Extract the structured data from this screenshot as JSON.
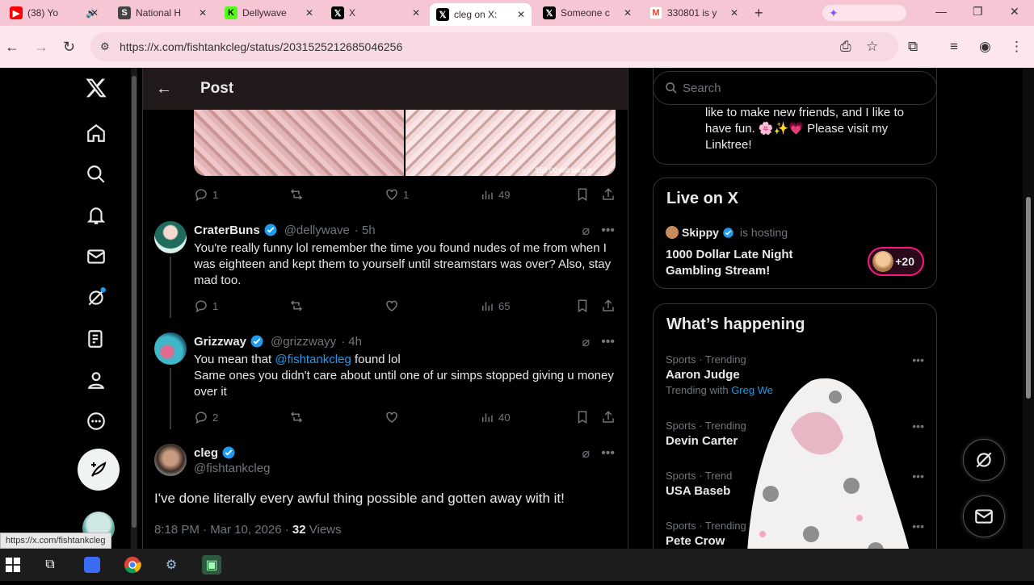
{
  "browser": {
    "tabs": [
      {
        "title": "(38) Yo",
        "icon": "youtube-icon",
        "color": "#ff0000"
      },
      {
        "title": "National H",
        "icon": "s-logo-icon",
        "color": "#333333"
      },
      {
        "title": "Dellywave",
        "icon": "k-logo-icon",
        "color": "#53fc18"
      },
      {
        "title": "X",
        "icon": "x-logo-icon",
        "color": "#000000"
      },
      {
        "title": "cleg on X:",
        "icon": "x-logo-icon",
        "color": "#000000"
      },
      {
        "title": "Someone c",
        "icon": "x-logo-icon",
        "color": "#000000"
      },
      {
        "title": "330801 is y",
        "icon": "gmail-icon",
        "color": "#ea4335"
      }
    ],
    "url": "https://x.com/fishtankcleg/status/2031525212685046256",
    "status_link": "https://x.com/fishtankcleg"
  },
  "header": {
    "title": "Post"
  },
  "image_caption": "$50.00 will take a",
  "parent_post_stats": {
    "replies": "1",
    "likes": "1",
    "views": "49"
  },
  "replies": [
    {
      "name": "CraterBuns",
      "handle": "@dellywave",
      "time": "· 5h",
      "text": "You're really funny lol remember the time you found nudes of me from when I was eighteen and kept them to yourself until streamstars was over?  Also, stay mad too.",
      "replies": "1",
      "views": "65"
    },
    {
      "name": "Grizzway",
      "handle": "@grizzwayy",
      "time": "· 4h",
      "mention": "@fishtankcleg",
      "text_before": "You mean that ",
      "text_after": " found lol",
      "text2": "Same ones you didn't care about until one of ur simps stopped giving u money over it",
      "replies": "2",
      "views": "40"
    }
  ],
  "focused_post": {
    "name": "cleg",
    "handle": "@fishtankcleg",
    "text": "I've done literally every awful thing possible and gotten away with it!",
    "datetime": "8:18 PM · Mar 10, 2026 · ",
    "views_count": "32",
    "views_label": " Views"
  },
  "sidebar": {
    "search_placeholder": "Search",
    "bio_line1": "like to make new friends, and I like to",
    "bio_line2": "have fun. 🌸✨💗 Please visit my",
    "bio_line3": "Linktree!",
    "live": {
      "heading": "Live on X",
      "host": "Skippy",
      "hosting": "is hosting",
      "title": "1000 Dollar Late Night Gambling Stream!",
      "badge": "+20"
    },
    "happening": {
      "heading": "What’s happening",
      "trends": [
        {
          "category": "Sports · Trending",
          "title": "Aaron Judge",
          "with_label": "Trending with",
          "with_link": "Greg We"
        },
        {
          "category": "Sports · Trending",
          "title": "Devin Carter"
        },
        {
          "category": "Sports · Trend",
          "title": "USA Baseb"
        },
        {
          "category": "Sports · Trending",
          "title": "Pete Crow"
        }
      ]
    }
  },
  "colors": {
    "accent": "#1d9bf0",
    "tabbar": "#f7c6d4",
    "live_ring": "#f91880"
  }
}
